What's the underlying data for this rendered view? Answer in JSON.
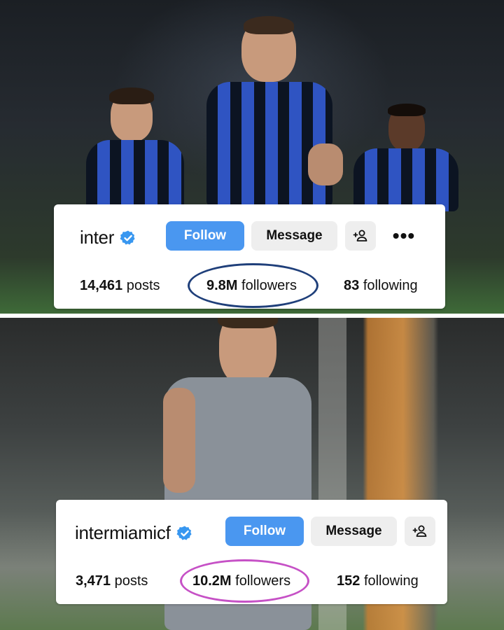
{
  "colors": {
    "follow_button": "#4a97f0",
    "secondary_button": "#eeeeee",
    "verified_badge": "#3897f0",
    "inter_highlight": "#1f3f7a",
    "miami_highlight": "#c651c6"
  },
  "profiles": [
    {
      "username": "inter",
      "verified_icon": "verified-badge-icon",
      "follow_label": "Follow",
      "message_label": "Message",
      "add_person_icon": "add-person-icon",
      "more_icon": "more-options-icon",
      "more_glyph": "•••",
      "posts_count": "14,461",
      "posts_label": "posts",
      "followers_count": "9.8M",
      "followers_label": "followers",
      "following_count": "83",
      "following_label": "following"
    },
    {
      "username": "intermiamicf",
      "verified_icon": "verified-badge-icon",
      "follow_label": "Follow",
      "message_label": "Message",
      "add_person_icon": "add-person-icon",
      "posts_count": "3,471",
      "posts_label": "posts",
      "followers_count": "10.2M",
      "followers_label": "followers",
      "following_count": "152",
      "following_label": "following"
    }
  ]
}
